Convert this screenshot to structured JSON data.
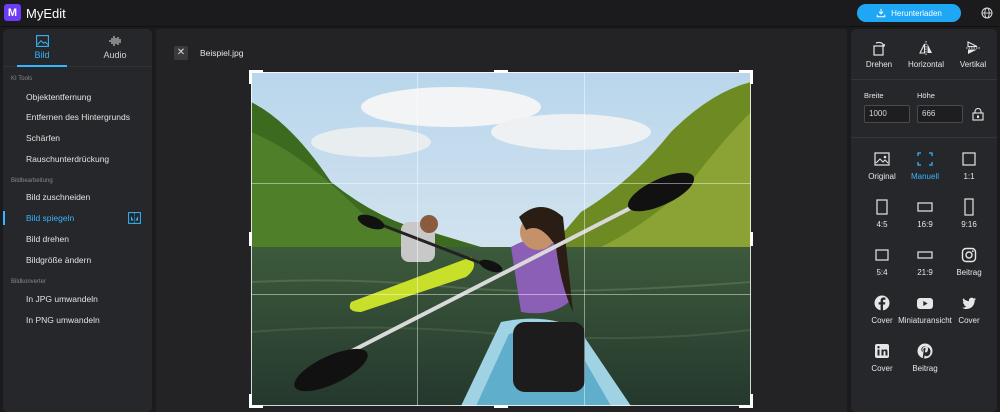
{
  "app": {
    "logo_letter": "M",
    "title": "MyEdit"
  },
  "header": {
    "download_label": "Herunterladen",
    "accent": "#1ea7f5"
  },
  "left_tabs": [
    {
      "label": "Bild",
      "icon": "image-icon",
      "active": true
    },
    {
      "label": "Audio",
      "icon": "audio-wave-icon",
      "active": false
    }
  ],
  "sections": {
    "ai_tools": "KI Tools",
    "image_editing": "Bildbearbeitung",
    "image_converter": "Bildkonverter"
  },
  "ai_tools_items": [
    "Objektentfernung",
    "Entfernen des Hintergrunds",
    "Schärfen",
    "Rauschunterdrückung"
  ],
  "editing_items": [
    "Bild zuschneiden",
    "Bild spiegeln",
    "Bild drehen",
    "Bildgröße ändern"
  ],
  "editing_active_index": 1,
  "converter_items": [
    "In JPG umwandeln",
    "In PNG umwandeln"
  ],
  "canvas": {
    "filename": "Beispiel.jpg",
    "close_symbol": "✕"
  },
  "transform": {
    "rotate": "Drehen",
    "horizontal": "Horizontal",
    "vertical": "Vertikal"
  },
  "size": {
    "width_label": "Breite",
    "height_label": "Höhe",
    "width_value": "1000",
    "height_value": "666"
  },
  "ratios": [
    {
      "label": "Original",
      "icon": "image-icon"
    },
    {
      "label": "Manuell",
      "icon": "freeform-crop-icon",
      "active": true
    },
    {
      "label": "1:1",
      "icon": "square-icon"
    },
    {
      "label": "4:5",
      "icon": "portrait-rect-icon"
    },
    {
      "label": "16:9",
      "icon": "wide-rect-icon"
    },
    {
      "label": "9:16",
      "icon": "tall-rect-icon"
    },
    {
      "label": "5:4",
      "icon": "landscape-rect-icon"
    },
    {
      "label": "21:9",
      "icon": "ultrawide-rect-icon"
    },
    {
      "label": "Beitrag",
      "icon": "instagram-icon"
    },
    {
      "label": "Cover",
      "icon": "facebook-icon"
    },
    {
      "label": "Miniaturansicht",
      "icon": "youtube-icon"
    },
    {
      "label": "Cover",
      "icon": "twitter-icon"
    },
    {
      "label": "Cover",
      "icon": "linkedin-icon"
    },
    {
      "label": "Beitrag",
      "icon": "pinterest-icon"
    }
  ]
}
